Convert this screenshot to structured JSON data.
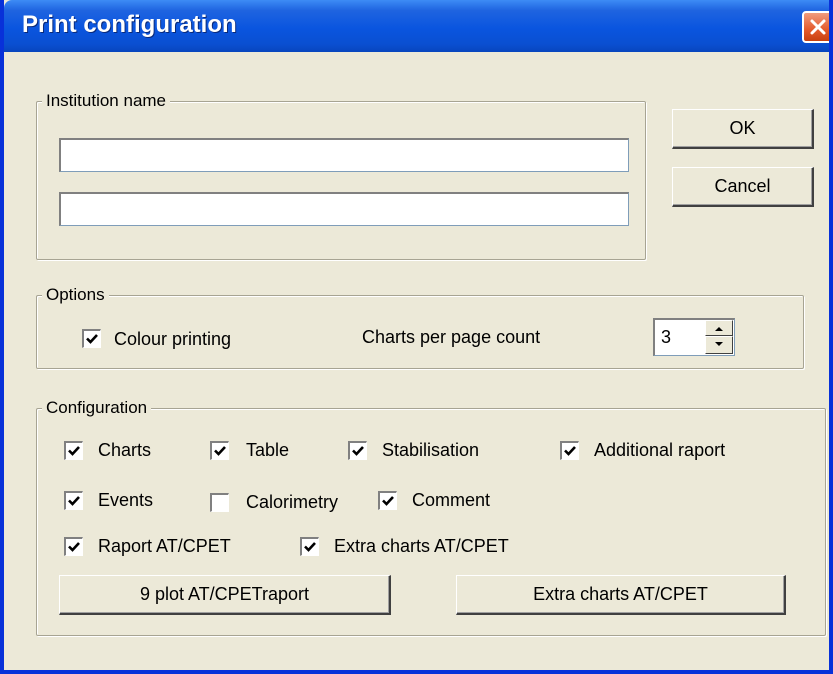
{
  "dialog": {
    "title": "Print configuration"
  },
  "institution": {
    "legend": "Institution name",
    "line1": "",
    "line2": ""
  },
  "buttons": {
    "ok": "OK",
    "cancel": "Cancel"
  },
  "options": {
    "legend": "Options",
    "colour_printing": {
      "label": "Colour printing",
      "checked": true
    },
    "charts_per_page": {
      "label": "Charts per page count",
      "value": "3"
    }
  },
  "configuration": {
    "legend": "Configuration",
    "charts": {
      "label": "Charts",
      "checked": true
    },
    "table": {
      "label": "Table",
      "checked": true
    },
    "stabilisation": {
      "label": "Stabilisation",
      "checked": true
    },
    "additional_raport": {
      "label": "Additional raport",
      "checked": true
    },
    "events": {
      "label": "Events",
      "checked": true
    },
    "calorimetry": {
      "label": "Calorimetry",
      "checked": false
    },
    "comment": {
      "label": "Comment",
      "checked": true
    },
    "raport_at_cpet": {
      "label": "Raport AT/CPET",
      "checked": true
    },
    "extra_charts": {
      "label": "Extra charts AT/CPET",
      "checked": true
    },
    "plot_button": "9 plot AT/CPETraport",
    "extra_button": "Extra charts AT/CPET"
  },
  "colors": {
    "titlebar": "#0a55df",
    "face": "#ece9d8",
    "close": "#e45a2c"
  }
}
